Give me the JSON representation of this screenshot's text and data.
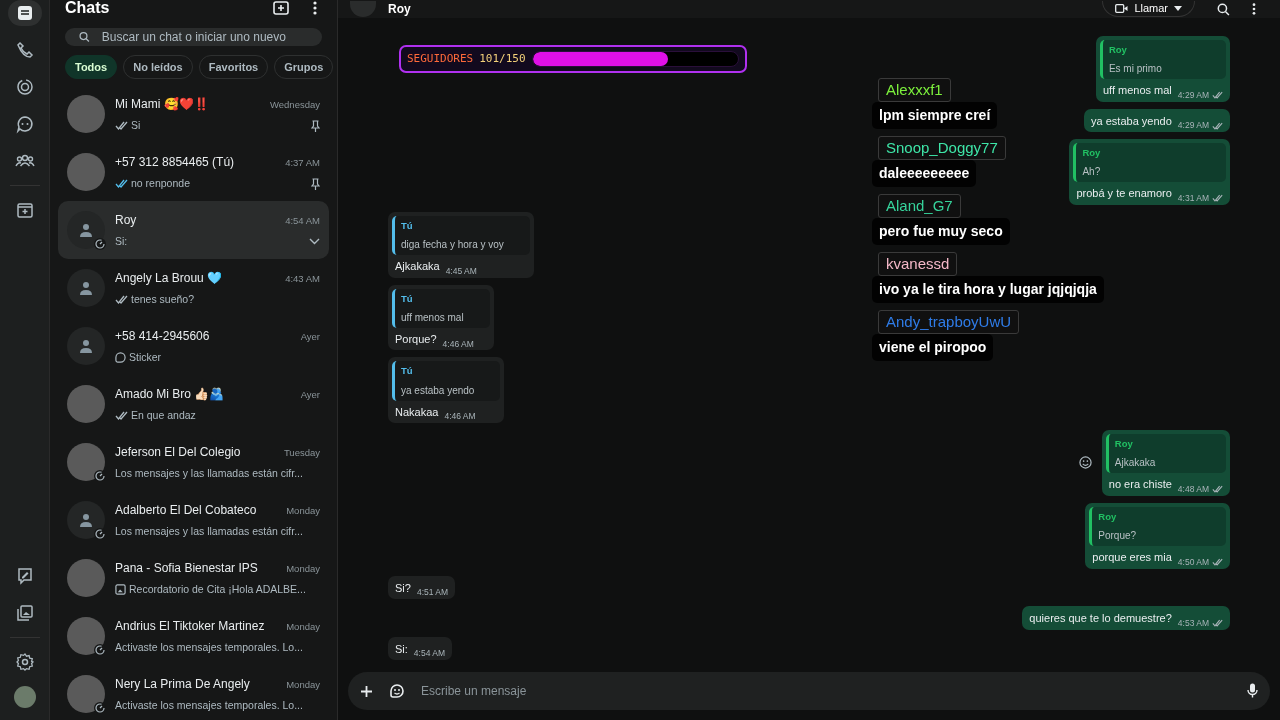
{
  "rail": {
    "top": [
      {
        "kind": "chats",
        "selected": true
      },
      {
        "kind": "calls",
        "selected": false
      },
      {
        "kind": "status",
        "selected": false
      },
      {
        "kind": "channels",
        "selected": false
      },
      {
        "kind": "communities",
        "selected": false
      },
      {
        "kind": "archive",
        "selected": false
      }
    ],
    "bottom": [
      {
        "kind": "ai",
        "selected": false
      },
      {
        "kind": "media",
        "selected": false
      },
      {
        "kind": "settings",
        "selected": false
      },
      {
        "kind": "profile",
        "selected": false
      }
    ]
  },
  "sidebar": {
    "title": "Chats",
    "search": {
      "placeholder": "Buscar un chat o iniciar uno nuevo"
    },
    "filters": [
      {
        "label": "Todos",
        "selected": true
      },
      {
        "label": "No leídos",
        "selected": false
      },
      {
        "label": "Favoritos",
        "selected": false
      },
      {
        "label": "Grupos",
        "selected": false
      }
    ],
    "chats": [
      {
        "name": "Mi Mami 🥰❤️‼️",
        "time": "Wednesday",
        "preview": "Si",
        "preview_icon": {
          "kind": "ticks",
          "read": false
        },
        "has_photo": true,
        "disappearing": false,
        "pinned": true,
        "selected": false
      },
      {
        "name": "+57 312 8854465 (Tú)",
        "time": "4:37 AM",
        "preview": "no renponde",
        "preview_icon": {
          "kind": "ticks",
          "read": true
        },
        "has_photo": true,
        "disappearing": false,
        "pinned": true,
        "selected": false
      },
      {
        "name": "Roy",
        "time": "4:54 AM",
        "preview": "Si:",
        "has_photo": false,
        "disappearing": true,
        "pinned": false,
        "selected": true
      },
      {
        "name": "Angely La Brouu 🩵",
        "time": "4:43 AM",
        "preview": "tenes sueño?",
        "preview_icon": {
          "kind": "ticks",
          "read": false
        },
        "has_photo": false,
        "disappearing": false,
        "pinned": false,
        "selected": false
      },
      {
        "name": "+58 414-2945606",
        "time": "Ayer",
        "preview": "Sticker",
        "preview_icon": {
          "kind": "sticker"
        },
        "has_photo": false,
        "disappearing": false,
        "pinned": false,
        "selected": false
      },
      {
        "name": "Amado Mi Bro 👍🏻🫂",
        "time": "Ayer",
        "preview": "En que andaz",
        "preview_icon": {
          "kind": "ticks",
          "read": false
        },
        "has_photo": true,
        "disappearing": false,
        "pinned": false,
        "selected": false
      },
      {
        "name": "Jeferson El Del Colegio",
        "time": "Tuesday",
        "preview": "Los mensajes y las llamadas están cifr...",
        "has_photo": true,
        "disappearing": true,
        "pinned": false,
        "selected": false
      },
      {
        "name": "Adalberto El Del Cobateco",
        "time": "Monday",
        "preview": "Los mensajes y las llamadas están cifr...",
        "has_photo": false,
        "disappearing": true,
        "pinned": false,
        "selected": false
      },
      {
        "name": "Pana - Sofia Bienestar IPS",
        "time": "Monday",
        "preview": "Recordatorio de Cita ¡Hola ADALBE...",
        "preview_icon": {
          "kind": "image"
        },
        "has_photo": true,
        "disappearing": false,
        "pinned": false,
        "selected": false
      },
      {
        "name": "Andrius El Tiktoker Martinez",
        "time": "Monday",
        "preview": "Activaste los mensajes temporales. Lo...",
        "has_photo": true,
        "disappearing": true,
        "pinned": false,
        "selected": false
      },
      {
        "name": "Nery La Prima De Angely",
        "time": "Monday",
        "preview": "Activaste los mensajes temporales. Lo...",
        "has_photo": true,
        "disappearing": true,
        "pinned": false,
        "selected": false
      }
    ]
  },
  "conversation": {
    "contact": "Roy",
    "call_button": "Llamar",
    "messages": [
      {
        "outgoing": true,
        "quote": {
          "author": "Roy",
          "text": "Es mi primo"
        },
        "text": "uff menos mal",
        "time": "4:29 AM",
        "reaction_button": false
      },
      {
        "outgoing": true,
        "text": "ya estaba yendo",
        "time": "4:29 AM",
        "reaction_button": false
      },
      {
        "outgoing": true,
        "quote": {
          "author": "Roy",
          "text": "Ah?"
        },
        "text": "probá y te enamoro",
        "time": "4:31 AM",
        "reaction_button": false
      },
      {
        "outgoing": false,
        "quote": {
          "author": "Tú",
          "text": "diga fecha y hora y voy"
        },
        "text": "Ajkakaka",
        "time": "4:45 AM",
        "reaction_button": false
      },
      {
        "outgoing": false,
        "quote": {
          "author": "Tú",
          "text": "uff menos mal"
        },
        "text": "Porque?",
        "time": "4:46 AM",
        "reaction_button": false
      },
      {
        "outgoing": false,
        "quote": {
          "author": "Tú",
          "text": "ya estaba yendo"
        },
        "text": "Nakakaa",
        "time": "4:46 AM",
        "reaction_button": false
      },
      {
        "outgoing": true,
        "quote": {
          "author": "Roy",
          "text": "Ajkakaka"
        },
        "text": "no era chiste",
        "time": "4:48 AM",
        "reaction_button": true
      },
      {
        "outgoing": true,
        "quote": {
          "author": "Roy",
          "text": "Porque?"
        },
        "text": "porque eres mia",
        "time": "4:50 AM",
        "reaction_button": false
      },
      {
        "outgoing": false,
        "text": "Si?",
        "time": "4:51 AM",
        "reaction_button": false
      },
      {
        "outgoing": true,
        "text": "quieres que te lo demuestre?",
        "time": "4:53 AM",
        "reaction_button": false
      },
      {
        "outgoing": false,
        "text": "Si:",
        "time": "4:54 AM",
        "reaction_button": false
      }
    ],
    "composer": {
      "placeholder": "Escribe un mensaje"
    }
  },
  "stream_overlay": {
    "goal": {
      "label": "SEGUIDORES",
      "count": "101/150",
      "level": 0.66
    },
    "chat": [
      {
        "user": "Alexxxf1",
        "color": "#7cf03c",
        "text": "lpm siempre creí"
      },
      {
        "user": "Snoop_Doggy77",
        "color": "#3ee6a8",
        "text": "daleeeeeeeee"
      },
      {
        "user": "Aland_G7",
        "color": "#36d49c",
        "text": "pero fue muy seco"
      },
      {
        "user": "kvanessd",
        "color": "#f4b8c8",
        "text": "ivo ya le tira hora y lugar jqjqjqja"
      },
      {
        "user": "Andy_trapboyUwU",
        "color": "#2f7ce8",
        "text": "viene el piropoo"
      }
    ]
  }
}
